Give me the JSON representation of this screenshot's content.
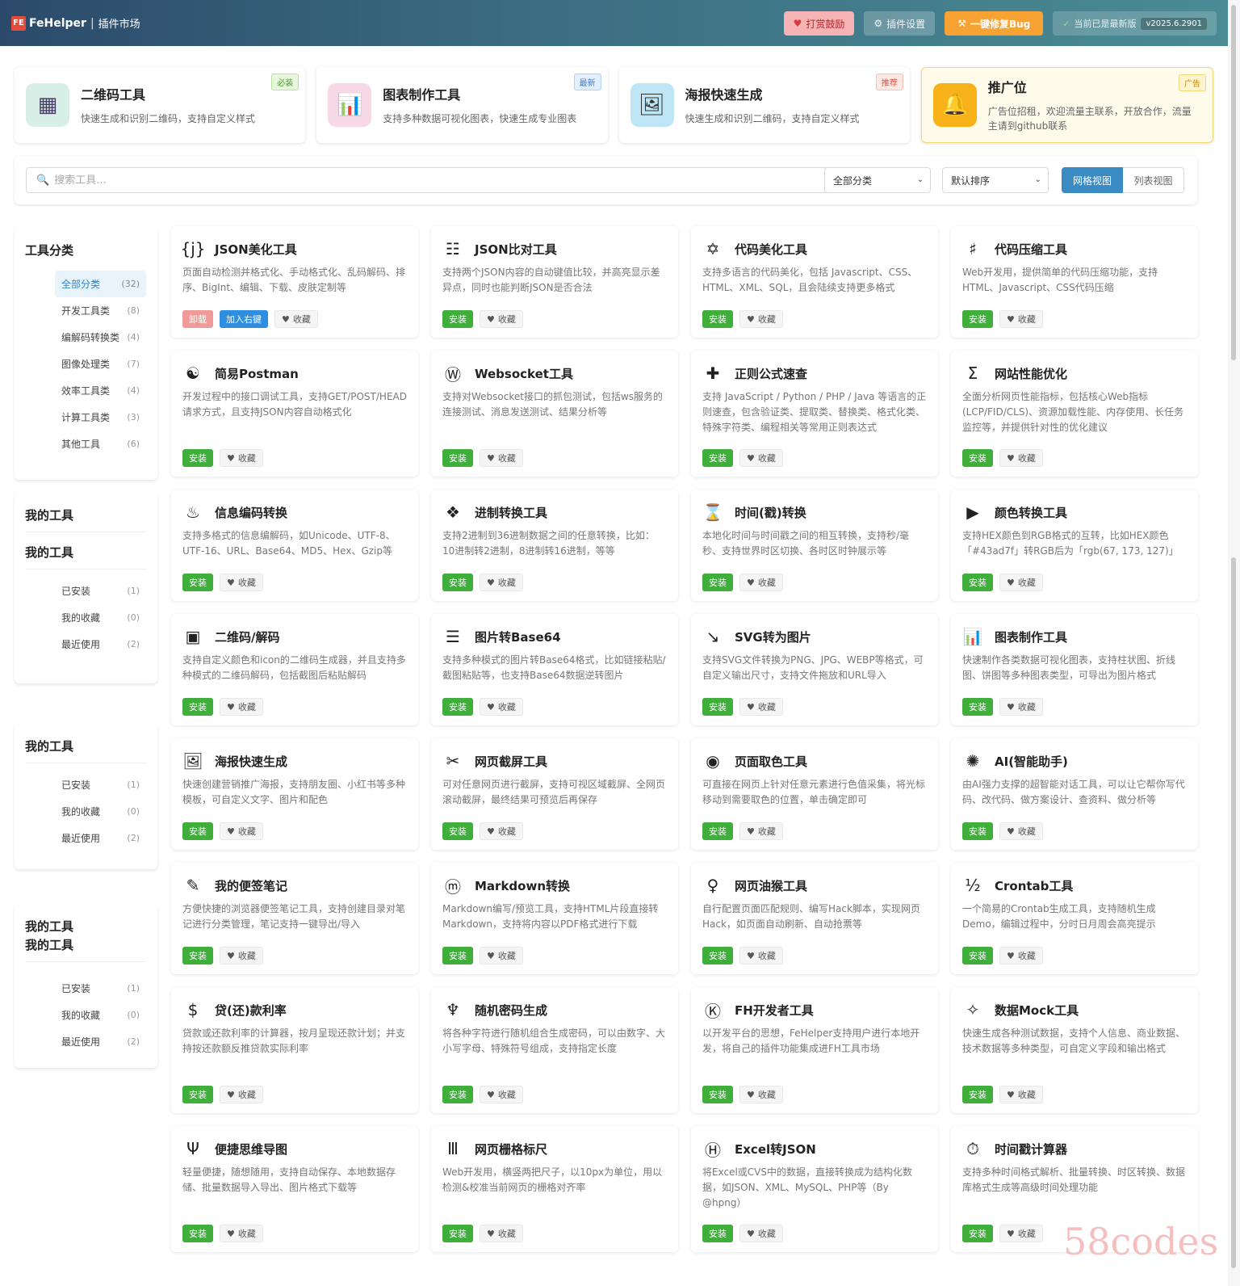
{
  "header": {
    "logo": "FE",
    "brand": "FeHelper",
    "separator": "|",
    "subtitle": "插件市场",
    "donate": "打赏鼓励",
    "settings": "插件设置",
    "fix_bug": "一键修复Bug",
    "version_status": "当前已是最新版",
    "version": "v2025.6.2901"
  },
  "featured": [
    {
      "title": "二维码工具",
      "desc": "快速生成和识别二维码，支持自定义样式",
      "badge": "必装",
      "icon": "qr-icon",
      "glyph": "▦"
    },
    {
      "title": "图表制作工具",
      "desc": "支持多种数据可视化图表，快速生成专业图表",
      "badge": "最新",
      "icon": "chart-icon",
      "glyph": "📊"
    },
    {
      "title": "海报快速生成",
      "desc": "快速生成和识别二维码，支持自定义样式",
      "badge": "推荐",
      "icon": "image-icon",
      "glyph": "🖼"
    },
    {
      "title": "推广位",
      "desc": "广告位招租，欢迎流量主联系，开放合作，流量主请到github联系",
      "badge": "广告",
      "icon": "bell-icon",
      "glyph": "🔔"
    }
  ],
  "search": {
    "placeholder": "搜索工具...",
    "category": "全部分类",
    "sort": "默认排序",
    "grid_view": "网格视图",
    "list_view": "列表视图"
  },
  "sidebar": {
    "category_title": "工具分类",
    "categories": [
      {
        "label": "全部分类",
        "count": "(32)"
      },
      {
        "label": "开发工具类",
        "count": "(8)"
      },
      {
        "label": "编解码转换类",
        "count": "(4)"
      },
      {
        "label": "图像处理类",
        "count": "(7)"
      },
      {
        "label": "效率工具类",
        "count": "(4)"
      },
      {
        "label": "计算工具类",
        "count": "(3)"
      },
      {
        "label": "其他工具",
        "count": "(6)"
      }
    ],
    "my_tools_title": "我的工具",
    "my_tools": [
      {
        "label": "已安装",
        "count": "(1)"
      },
      {
        "label": "我的收藏",
        "count": "(0)"
      },
      {
        "label": "最近使用",
        "count": "(2)"
      }
    ]
  },
  "actions": {
    "install": "安装",
    "uninstall": "卸载",
    "right_key": "加入右键",
    "favorite": "收藏"
  },
  "tools": [
    {
      "name": "JSON美化工具",
      "desc": "页面自动检测并格式化、手动格式化、乱码解码、排序、BigInt、编辑、下载、皮肤定制等",
      "icon": "json-icon",
      "glyph": "{j}",
      "installed": true
    },
    {
      "name": "JSON比对工具",
      "desc": "支持两个JSON内容的自动键值比较，并高亮显示差异点，同时也能判断JSON是否合法",
      "icon": "compare-icon",
      "glyph": "☷"
    },
    {
      "name": "代码美化工具",
      "desc": "支持多语言的代码美化，包括 Javascript、CSS、HTML、XML、SQL，且会陆续支持更多格式",
      "icon": "star-icon",
      "glyph": "✡"
    },
    {
      "name": "代码压缩工具",
      "desc": "Web开发用，提供简单的代码压缩功能，支持HTML、Javascript、CSS代码压缩",
      "icon": "hash-icon",
      "glyph": "♯"
    },
    {
      "name": "简易Postman",
      "desc": "开发过程中的接口调试工具，支持GET/POST/HEAD请求方式，且支持JSON内容自动格式化",
      "icon": "yinyang-icon",
      "glyph": "☯"
    },
    {
      "name": "Websocket工具",
      "desc": "支持对Websocket接口的抓包测试，包括ws服务的连接测试、消息发送测试、结果分析等",
      "icon": "w-icon",
      "glyph": "Ⓦ"
    },
    {
      "name": "正则公式速查",
      "desc": "支持 JavaScript / Python / PHP / Java 等语言的正则速查，包含验证类、提取类、替换类、格式化类、特殊字符类、编程相关等常用正则表达式",
      "icon": "cross-icon",
      "glyph": "✚"
    },
    {
      "name": "网站性能优化",
      "desc": "全面分析网页性能指标，包括核心Web指标(LCP/FID/CLS)、资源加载性能、内存使用、长任务监控等，并提供针对性的优化建议",
      "icon": "sigma-icon",
      "glyph": "Σ"
    },
    {
      "name": "信息编码转换",
      "desc": "支持多格式的信息编解码，如Unicode、UTF-8、UTF-16、URL、Base64、MD5、Hex、Gzip等",
      "icon": "hotspring-icon",
      "glyph": "♨"
    },
    {
      "name": "进制转换工具",
      "desc": "支持2进制到36进制数据之间的任意转换，比如：10进制转2进制，8进制转16进制，等等",
      "icon": "diamonds-icon",
      "glyph": "❖"
    },
    {
      "name": "时间(戳)转换",
      "desc": "本地化时间与时间戳之间的相互转换，支持秒/毫秒、支持世界时区切换、各时区时钟展示等",
      "icon": "hourglass-icon",
      "glyph": "⌛"
    },
    {
      "name": "颜色转换工具",
      "desc": "支持HEX颜色到RGB格式的互转，比如HEX颜色「#43ad7f」转RGB后为「rgb(67, 173, 127)」",
      "icon": "play-icon",
      "glyph": "▶"
    },
    {
      "name": "二维码/解码",
      "desc": "支持自定义颜色和icon的二维码生成器，并且支持多种模式的二维码解码，包括截图后粘贴解码",
      "icon": "square-icon",
      "glyph": "▣"
    },
    {
      "name": "图片转Base64",
      "desc": "支持多种模式的图片转Base64格式，比如链接粘贴/截图粘贴等，也支持Base64数据逆转图片",
      "icon": "lines-icon",
      "glyph": "☰"
    },
    {
      "name": "SVG转为图片",
      "desc": "支持SVG文件转换为PNG、JPG、WEBP等格式，可自定义输出尺寸，支持文件拖放和URL导入",
      "icon": "arrow-icon",
      "glyph": "↘"
    },
    {
      "name": "图表制作工具",
      "desc": "快速制作各类数据可视化图表，支持柱状图、折线图、饼图等多种图表类型，可导出为图片格式",
      "icon": "barchart-icon",
      "glyph": "📊"
    },
    {
      "name": "海报快速生成",
      "desc": "快速创建营销推广海报，支持朋友圈、小红书等多种模板，可自定义文字、图片和配色",
      "icon": "picture-icon",
      "glyph": "🖼"
    },
    {
      "name": "网页截屏工具",
      "desc": "可对任意网页进行截屏，支持可视区域截屏、全网页滚动截屏，最终结果可预览后再保存",
      "icon": "scissors-icon",
      "glyph": "✂"
    },
    {
      "name": "页面取色工具",
      "desc": "可直接在网页上针对任意元素进行色值采集，将光标移动到需要取色的位置，单击确定即可",
      "icon": "eye-icon",
      "glyph": "◉"
    },
    {
      "name": "AI(智能助手)",
      "desc": "由AI强力支撑的超智能对话工具，可以让它帮你写代码、改代码、做方案设计、查资料、做分析等",
      "icon": "ai-icon",
      "glyph": "✺"
    },
    {
      "name": "我的便签笔记",
      "desc": "方便快捷的浏览器便签笔记工具，支持创建目录对笔记进行分类管理，笔记支持一键导出/导入",
      "icon": "pencil-icon",
      "glyph": "✎"
    },
    {
      "name": "Markdown转换",
      "desc": "Markdown编写/预览工具，支持HTML片段直接转Markdown，支持将内容以PDF格式进行下载",
      "icon": "m-icon",
      "glyph": "ⓜ"
    },
    {
      "name": "网页油猴工具",
      "desc": "自行配置页面匹配规则、编写Hack脚本，实现网页Hack，如页面自动刷新、自动抢票等",
      "icon": "pin-icon",
      "glyph": "♀"
    },
    {
      "name": "Crontab工具",
      "desc": "一个简易的Crontab生成工具，支持随机生成Demo，编辑过程中，分时日月周会高亮提示",
      "icon": "half-icon",
      "glyph": "½"
    },
    {
      "name": "贷(还)款利率",
      "desc": "贷款或还款利率的计算器，按月呈现还款计划；并支持按还款额反推贷款实际利率",
      "icon": "dollar-icon",
      "glyph": "$"
    },
    {
      "name": "随机密码生成",
      "desc": "将各种字符进行随机组合生成密码，可以由数字、大小写字母、特殊符号组成，支持指定长度",
      "icon": "trident-icon",
      "glyph": "♆"
    },
    {
      "name": "FH开发者工具",
      "desc": "以开发平台的思想，FeHelper支持用户进行本地开发，将自己的插件功能集成进FH工具市场",
      "icon": "k-icon",
      "glyph": "Ⓚ"
    },
    {
      "name": "数据Mock工具",
      "desc": "快速生成各种测试数据，支持个人信息、商业数据、技术数据等多种类型，可自定义字段和输出格式",
      "icon": "diamond-icon",
      "glyph": "✧"
    },
    {
      "name": "便捷思维导图",
      "desc": "轻量便捷，随想随用，支持自动保存、本地数据存储、批量数据导入导出、图片格式下载等",
      "icon": "psi-icon",
      "glyph": "Ψ"
    },
    {
      "name": "网页栅格标尺",
      "desc": "Web开发用，横竖两把尺子，以10px为单位，用以检测&校准当前网页的栅格对齐率",
      "icon": "ruler-icon",
      "glyph": "Ⅲ"
    },
    {
      "name": "Excel转JSON",
      "desc": "将Excel或CVS中的数据，直接转换成为结构化数据，如JSON、XML、MySQL、PHP等（By @hpng）",
      "icon": "h-icon",
      "glyph": "Ⓗ"
    },
    {
      "name": "时间戳计算器",
      "desc": "支持多种时间格式解析、批量转换、时区转换、数据库格式生成等高级时间处理功能",
      "icon": "stopwatch-icon",
      "glyph": "⏱"
    }
  ],
  "watermark": "58codes",
  "colors": {
    "install": "#3fae3a",
    "accent": "#3a8bc4",
    "uninstall": "#f19a9a",
    "right_key": "#2e8ee0"
  }
}
